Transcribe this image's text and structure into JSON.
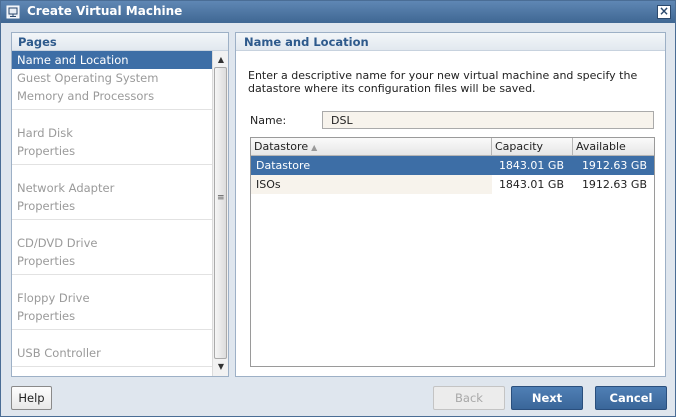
{
  "window": {
    "title": "Create Virtual Machine",
    "close_glyph": "×"
  },
  "pages": {
    "header": "Pages",
    "groups": [
      {
        "items": [
          {
            "label": "Name and Location",
            "selected": true
          },
          {
            "label": "Guest Operating System",
            "selected": false
          },
          {
            "label": "Memory and Processors",
            "selected": false
          }
        ]
      },
      {
        "items": [
          {
            "label": "Hard Disk",
            "selected": false
          },
          {
            "label": "Properties",
            "selected": false
          }
        ]
      },
      {
        "items": [
          {
            "label": "Network Adapter",
            "selected": false
          },
          {
            "label": "Properties",
            "selected": false
          }
        ]
      },
      {
        "items": [
          {
            "label": "CD/DVD Drive",
            "selected": false
          },
          {
            "label": "Properties",
            "selected": false
          }
        ]
      },
      {
        "items": [
          {
            "label": "Floppy Drive",
            "selected": false
          },
          {
            "label": "Properties",
            "selected": false
          }
        ]
      },
      {
        "items": [
          {
            "label": "USB Controller",
            "selected": false
          }
        ]
      }
    ]
  },
  "content": {
    "header": "Name and Location",
    "description": "Enter a descriptive name for your new virtual machine and specify the datastore where its configuration files will be saved.",
    "name_label": "Name:",
    "name_value": "DSL"
  },
  "datastore_table": {
    "columns": [
      "Datastore",
      "Capacity",
      "Available"
    ],
    "rows": [
      {
        "datastore": "Datastore",
        "capacity": "1843.01 GB",
        "available": "1912.63 GB",
        "selected": true
      },
      {
        "datastore": "ISOs",
        "capacity": "1843.01 GB",
        "available": "1912.63 GB",
        "selected": false
      }
    ]
  },
  "buttons": {
    "help": "Help",
    "back": "Back",
    "next": "Next",
    "cancel": "Cancel"
  },
  "icons": {
    "window": "vm-window-icon",
    "sort": "sort-ascending-icon",
    "scroll_up": "scroll-up-arrow-icon",
    "scroll_down": "scroll-down-arrow-icon"
  },
  "colors": {
    "titlebar": "#4f77a4",
    "selection": "#3d6ea6",
    "header_text": "#2e5a8c"
  }
}
